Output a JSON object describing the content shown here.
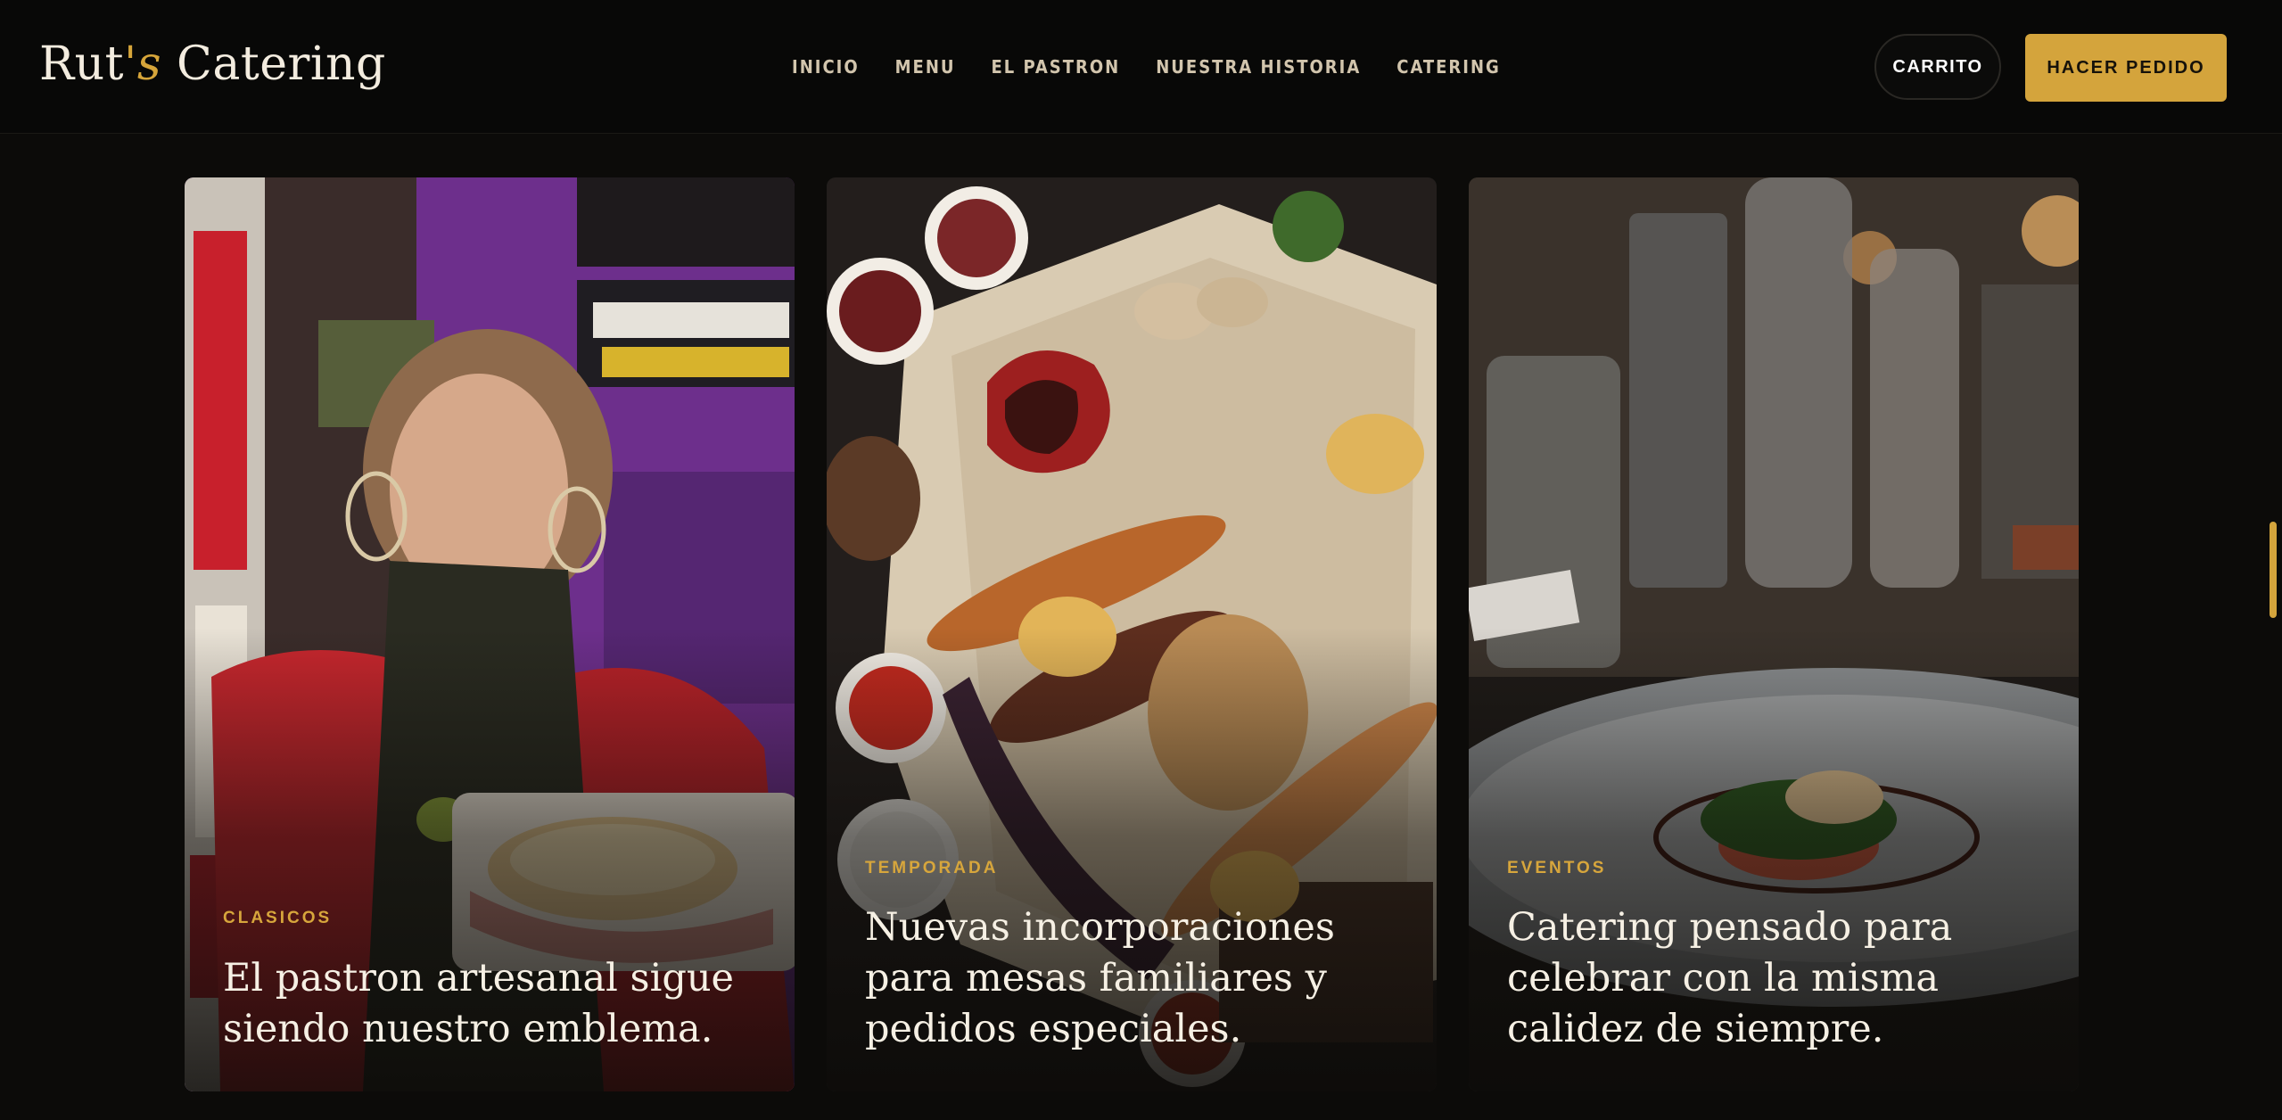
{
  "brand": {
    "name_part1": "Rut",
    "name_accent": "'s",
    "name_part2": " Catering"
  },
  "nav": {
    "items": [
      "INICIO",
      "MENU",
      "EL PASTRON",
      "NUESTRA HISTORIA",
      "CATERING"
    ]
  },
  "actions": {
    "cart_label": "CARRITO",
    "order_label": "HACER PEDIDO"
  },
  "cards": [
    {
      "tag": "CLASICOS",
      "title": "El pastron artesanal sigue siendo nuestro emblema."
    },
    {
      "tag": "TEMPORADA",
      "title": "Nuevas incorporaciones para mesas familiares y pedidos especiales."
    },
    {
      "tag": "EVENTOS",
      "title": "Catering pensado para celebrar con la misma calidez de siempre."
    }
  ],
  "colors": {
    "accent": "#d4a43c",
    "background": "#0c0b09",
    "text": "#f6f0e4"
  }
}
